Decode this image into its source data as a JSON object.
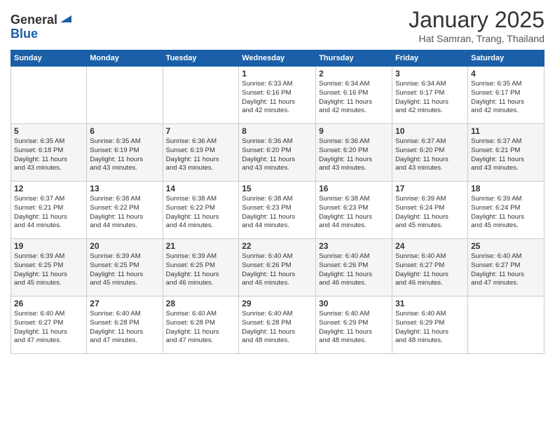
{
  "logo": {
    "line1": "General",
    "line2": "Blue"
  },
  "header": {
    "month": "January 2025",
    "location": "Hat Samran, Trang, Thailand"
  },
  "weekdays": [
    "Sunday",
    "Monday",
    "Tuesday",
    "Wednesday",
    "Thursday",
    "Friday",
    "Saturday"
  ],
  "weeks": [
    [
      {
        "day": "",
        "info": ""
      },
      {
        "day": "",
        "info": ""
      },
      {
        "day": "",
        "info": ""
      },
      {
        "day": "1",
        "info": "Sunrise: 6:33 AM\nSunset: 6:16 PM\nDaylight: 11 hours\nand 42 minutes."
      },
      {
        "day": "2",
        "info": "Sunrise: 6:34 AM\nSunset: 6:16 PM\nDaylight: 11 hours\nand 42 minutes."
      },
      {
        "day": "3",
        "info": "Sunrise: 6:34 AM\nSunset: 6:17 PM\nDaylight: 11 hours\nand 42 minutes."
      },
      {
        "day": "4",
        "info": "Sunrise: 6:35 AM\nSunset: 6:17 PM\nDaylight: 11 hours\nand 42 minutes."
      }
    ],
    [
      {
        "day": "5",
        "info": "Sunrise: 6:35 AM\nSunset: 6:18 PM\nDaylight: 11 hours\nand 43 minutes."
      },
      {
        "day": "6",
        "info": "Sunrise: 6:35 AM\nSunset: 6:19 PM\nDaylight: 11 hours\nand 43 minutes."
      },
      {
        "day": "7",
        "info": "Sunrise: 6:36 AM\nSunset: 6:19 PM\nDaylight: 11 hours\nand 43 minutes."
      },
      {
        "day": "8",
        "info": "Sunrise: 6:36 AM\nSunset: 6:20 PM\nDaylight: 11 hours\nand 43 minutes."
      },
      {
        "day": "9",
        "info": "Sunrise: 6:36 AM\nSunset: 6:20 PM\nDaylight: 11 hours\nand 43 minutes."
      },
      {
        "day": "10",
        "info": "Sunrise: 6:37 AM\nSunset: 6:20 PM\nDaylight: 11 hours\nand 43 minutes."
      },
      {
        "day": "11",
        "info": "Sunrise: 6:37 AM\nSunset: 6:21 PM\nDaylight: 11 hours\nand 43 minutes."
      }
    ],
    [
      {
        "day": "12",
        "info": "Sunrise: 6:37 AM\nSunset: 6:21 PM\nDaylight: 11 hours\nand 44 minutes."
      },
      {
        "day": "13",
        "info": "Sunrise: 6:38 AM\nSunset: 6:22 PM\nDaylight: 11 hours\nand 44 minutes."
      },
      {
        "day": "14",
        "info": "Sunrise: 6:38 AM\nSunset: 6:22 PM\nDaylight: 11 hours\nand 44 minutes."
      },
      {
        "day": "15",
        "info": "Sunrise: 6:38 AM\nSunset: 6:23 PM\nDaylight: 11 hours\nand 44 minutes."
      },
      {
        "day": "16",
        "info": "Sunrise: 6:38 AM\nSunset: 6:23 PM\nDaylight: 11 hours\nand 44 minutes."
      },
      {
        "day": "17",
        "info": "Sunrise: 6:39 AM\nSunset: 6:24 PM\nDaylight: 11 hours\nand 45 minutes."
      },
      {
        "day": "18",
        "info": "Sunrise: 6:39 AM\nSunset: 6:24 PM\nDaylight: 11 hours\nand 45 minutes."
      }
    ],
    [
      {
        "day": "19",
        "info": "Sunrise: 6:39 AM\nSunset: 6:25 PM\nDaylight: 11 hours\nand 45 minutes."
      },
      {
        "day": "20",
        "info": "Sunrise: 6:39 AM\nSunset: 6:25 PM\nDaylight: 11 hours\nand 45 minutes."
      },
      {
        "day": "21",
        "info": "Sunrise: 6:39 AM\nSunset: 6:25 PM\nDaylight: 11 hours\nand 46 minutes."
      },
      {
        "day": "22",
        "info": "Sunrise: 6:40 AM\nSunset: 6:26 PM\nDaylight: 11 hours\nand 46 minutes."
      },
      {
        "day": "23",
        "info": "Sunrise: 6:40 AM\nSunset: 6:26 PM\nDaylight: 11 hours\nand 46 minutes."
      },
      {
        "day": "24",
        "info": "Sunrise: 6:40 AM\nSunset: 6:27 PM\nDaylight: 11 hours\nand 46 minutes."
      },
      {
        "day": "25",
        "info": "Sunrise: 6:40 AM\nSunset: 6:27 PM\nDaylight: 11 hours\nand 47 minutes."
      }
    ],
    [
      {
        "day": "26",
        "info": "Sunrise: 6:40 AM\nSunset: 6:27 PM\nDaylight: 11 hours\nand 47 minutes."
      },
      {
        "day": "27",
        "info": "Sunrise: 6:40 AM\nSunset: 6:28 PM\nDaylight: 11 hours\nand 47 minutes."
      },
      {
        "day": "28",
        "info": "Sunrise: 6:40 AM\nSunset: 6:28 PM\nDaylight: 11 hours\nand 47 minutes."
      },
      {
        "day": "29",
        "info": "Sunrise: 6:40 AM\nSunset: 6:28 PM\nDaylight: 11 hours\nand 48 minutes."
      },
      {
        "day": "30",
        "info": "Sunrise: 6:40 AM\nSunset: 6:29 PM\nDaylight: 11 hours\nand 48 minutes."
      },
      {
        "day": "31",
        "info": "Sunrise: 6:40 AM\nSunset: 6:29 PM\nDaylight: 11 hours\nand 48 minutes."
      },
      {
        "day": "",
        "info": ""
      }
    ]
  ]
}
